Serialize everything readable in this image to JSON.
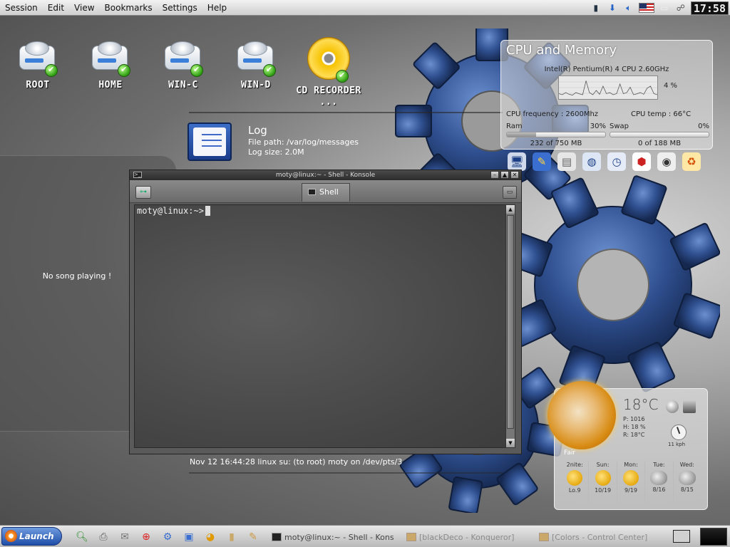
{
  "menubar": {
    "items": [
      "Session",
      "Edit",
      "View",
      "Bookmarks",
      "Settings",
      "Help"
    ],
    "clock": "17:58",
    "tray_icons": [
      "usb-icon",
      "download-icon",
      "volume-icon",
      "keyboard-layout-flag-icon",
      "clipboard-icon",
      "network-icon"
    ]
  },
  "desktop_icons": [
    {
      "label": "ROOT",
      "type": "drive"
    },
    {
      "label": "HOME",
      "type": "drive"
    },
    {
      "label": "WIN-C",
      "type": "drive"
    },
    {
      "label": "WIN-D",
      "type": "drive"
    },
    {
      "label": "CD RECORDER ...",
      "type": "cd"
    }
  ],
  "cpu_widget": {
    "title": "CPU and Memory",
    "model": "Intel(R) Pentium(R) 4 CPU 2.60GHz",
    "usage": "4 %",
    "frequency": "CPU frequency : 2600Mhz",
    "temp": "CPU temp : 66°C",
    "ram_label": "Ram",
    "ram_pct": "30%",
    "ram_value": "232 of 750 MB",
    "ram_fraction": 0.3,
    "swap_label": "Swap",
    "swap_pct": "0%",
    "swap_value": "0 of 188 MB",
    "swap_fraction": 0.0,
    "cpu_history": [
      0.25,
      0.2,
      0.3,
      0.22,
      0.18,
      0.3,
      0.24,
      0.2,
      0.85,
      0.3,
      0.2,
      0.4,
      0.22,
      0.6,
      0.25,
      0.3,
      0.2,
      0.25,
      0.7,
      0.25,
      0.3,
      0.55,
      0.2,
      0.24,
      0.3,
      0.22,
      0.5,
      0.6,
      0.25,
      0.2
    ]
  },
  "quick_launch": [
    "monitor-icon",
    "tools-icon",
    "hard-drive-icon",
    "globe-icon",
    "clock-icon",
    "pdf-icon",
    "cd-icon",
    "trash-icon"
  ],
  "log_widget": {
    "title": "Log",
    "path": "File path: /var/log/messages",
    "size": "Log size: 2.0M",
    "entry": "Nov 12 16:44:28 linux su: (to root) moty on /dev/pts/3"
  },
  "media": {
    "status": "No song playing !"
  },
  "konsole": {
    "title": "moty@linux:~ - Shell - Konsole",
    "tab_label": "Shell",
    "prompt": "moty@linux:~>"
  },
  "weather": {
    "temp": "18°C",
    "pressure": "P:  1016",
    "humidity": "H:  18 %",
    "realfeel": "R:  18°C",
    "wind": "11 kph",
    "condition": "Fair",
    "days": [
      {
        "name": "2nite:",
        "temps": "Lo.9",
        "icon": "sun"
      },
      {
        "name": "Sun:",
        "temps": "10/19",
        "icon": "sun"
      },
      {
        "name": "Mon:",
        "temps": "9/19",
        "icon": "sun"
      },
      {
        "name": "Tue:",
        "temps": "8/16",
        "icon": "cloud"
      },
      {
        "name": "Wed:",
        "temps": "8/15",
        "icon": "cloud"
      }
    ]
  },
  "taskbar": {
    "launch_label": "Launch",
    "apps": [
      "search-icon",
      "printer-icon",
      "mail-icon",
      "help-icon",
      "settings-icon",
      "game-icon",
      "media-icon",
      "notes-icon",
      "edit-icon"
    ],
    "tasks": [
      "moty@linux:~ - Shell - Kons",
      "[blackDeco - Konqueror]",
      "[Colors - Control Center]"
    ]
  }
}
